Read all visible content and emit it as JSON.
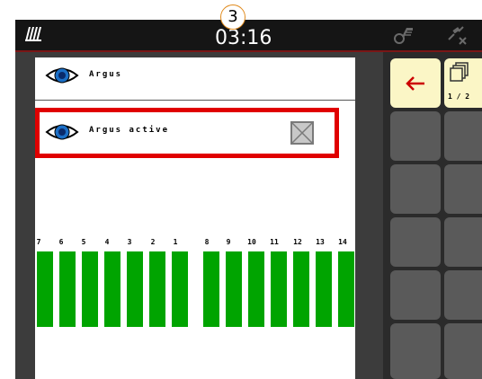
{
  "status_bar": {
    "time": "03:16",
    "badge": "3",
    "icons": [
      "signal-icon",
      "machine-icon",
      "gps-icon"
    ]
  },
  "panel": {
    "argus_label": "Argus",
    "argus_active_label": "Argus active",
    "argus_active_checked": false,
    "row_numbers": [
      "7",
      "6",
      "5",
      "4",
      "3",
      "2",
      "1",
      "8",
      "9",
      "10",
      "11",
      "12",
      "13",
      "14"
    ],
    "row_color": "#00a400"
  },
  "sidebar": {
    "back_icon": "arrow-left-icon",
    "pages_icon": "copy-pages-icon",
    "page_label": "1 / 2"
  },
  "colors": {
    "highlight": "#e00000",
    "back_arrow": "#cc0000",
    "yellow_button": "#fbf6c6"
  }
}
